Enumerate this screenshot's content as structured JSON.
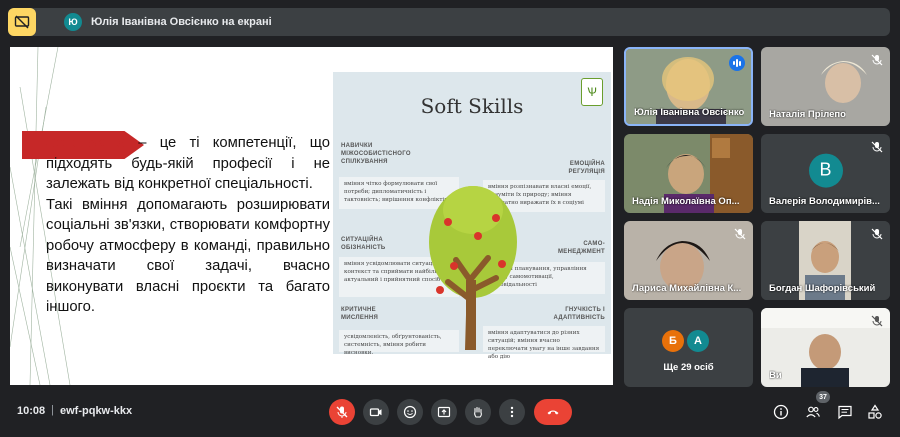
{
  "presentation_bar": {
    "presenter_initial": "Ю",
    "label": "Юлія Іванівна Овсієнко на екрані"
  },
  "slide": {
    "highlight": "Soft skills",
    "paragraph1": " – це ті компетенції, що підходять будь-якій професії і не залежать від конкретної спеціальності.",
    "paragraph2": "Такі вміння допомагають розширювати соціальні зв'язки, створювати комфортну робочу атмосферу в команді, правильно визначати свої задачі, вчасно виконувати власні проєкти та багато іншого.",
    "infographic": {
      "title": "Soft Skills",
      "sections": [
        {
          "head": "Навички міжособистісного спілкування",
          "text": "вміння чітко формулювати свої потреби; дипломатичність і тактовність; вирішення конфліктів"
        },
        {
          "head": "Ситуаційна обізнаність",
          "text": "вміння усвідомлювати ситуацію і її контекст та сприймати найбільш актуальний і прийнятний спосіб дії"
        },
        {
          "head": "Критичне мислення",
          "text": "усвідомленість, обґрунтованість, системність, вміння робити висновки."
        },
        {
          "head": "Емоційна регуляція",
          "text": "вміння розпізнавати власні емоції, розуміти їх природу; вміння адекватно виражати їх в соціумі"
        },
        {
          "head": "Само-менеджмент",
          "text": "навички планування, управління часом, самомотивації, відповідальності"
        },
        {
          "head": "Гнучкість і адаптивність",
          "text": "вміння адаптуватися до різних ситуацій; вміння вчасно переключати увагу на інше завдання або дію"
        }
      ]
    }
  },
  "participants": [
    {
      "name": "Юлія Іванівна Овсієнко",
      "state": "speaking"
    },
    {
      "name": "Наталія Прілепо",
      "state": "muted"
    },
    {
      "name": "Надія Миколаївна Оп...",
      "state": "video"
    },
    {
      "name": "Валерія Володимирів...",
      "state": "muted",
      "initial": "В"
    },
    {
      "name": "Лариса Михайлівна К...",
      "state": "muted"
    },
    {
      "name": "Богдан Шафорівський",
      "state": "muted"
    },
    {
      "name": "Ви",
      "state": "muted"
    }
  ],
  "more_tile": {
    "initials": [
      "Б",
      "А"
    ],
    "colors": [
      "#e8710a",
      "#128a91"
    ],
    "label": "Ще 29 осіб"
  },
  "bottom": {
    "time": "10:08",
    "separator": "|",
    "meeting_code": "ewf-pqkw-kkx",
    "people_count": "37"
  },
  "colors": {
    "background": "#202124",
    "bar": "#3c4043",
    "danger": "#ea4335",
    "accent": "#8ab4f8",
    "presenting": "#fdd663"
  }
}
